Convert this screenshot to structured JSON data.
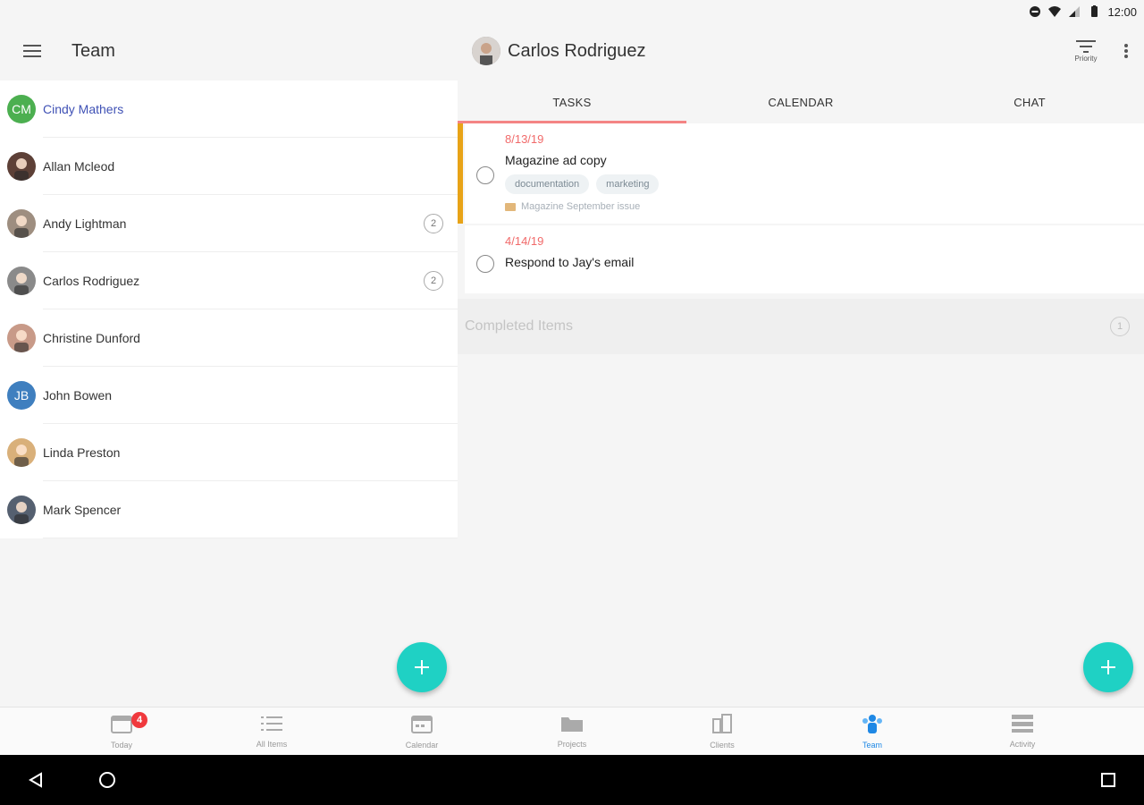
{
  "status_bar": {
    "time": "12:00"
  },
  "left": {
    "title": "Team",
    "members": [
      {
        "name": "Cindy Mathers",
        "initials": "CM",
        "avatar_color": "#4caf50",
        "selected": true,
        "count": ""
      },
      {
        "name": "Allan Mcleod",
        "initials": "",
        "avatar_color": "#5d4037",
        "selected": false,
        "count": ""
      },
      {
        "name": "Andy Lightman",
        "initials": "",
        "avatar_color": "#9e8e80",
        "selected": false,
        "count": "2"
      },
      {
        "name": "Carlos Rodriguez",
        "initials": "",
        "avatar_color": "#8a8a8a",
        "selected": false,
        "count": "2"
      },
      {
        "name": "Christine Dunford",
        "initials": "",
        "avatar_color": "#c89a88",
        "selected": false,
        "count": ""
      },
      {
        "name": "John Bowen",
        "initials": "JB",
        "avatar_color": "#3f7fbf",
        "selected": false,
        "count": ""
      },
      {
        "name": "Linda Preston",
        "initials": "",
        "avatar_color": "#d9b07a",
        "selected": false,
        "count": ""
      },
      {
        "name": "Mark Spencer",
        "initials": "",
        "avatar_color": "#556070",
        "selected": false,
        "count": ""
      }
    ]
  },
  "right": {
    "title": "Carlos Rodriguez",
    "filter_label": "Priority",
    "tabs": [
      {
        "label": "TASKS",
        "active": true
      },
      {
        "label": "CALENDAR",
        "active": false
      },
      {
        "label": "CHAT",
        "active": false
      }
    ],
    "tasks": [
      {
        "date": "8/13/19",
        "title": "Magazine ad copy",
        "tags": [
          "documentation",
          "marketing"
        ],
        "project": "Magazine September issue",
        "priority_color": "#e8a317"
      },
      {
        "date": "4/14/19",
        "title": "Respond to Jay's email",
        "tags": [],
        "project": "",
        "priority_color": ""
      }
    ],
    "completed_label": "Completed Items",
    "completed_count": "1"
  },
  "bottom_nav": [
    {
      "label": "Today",
      "icon": "calendar-today-icon",
      "badge": "4",
      "active": false
    },
    {
      "label": "All Items",
      "icon": "list-icon",
      "badge": "",
      "active": false
    },
    {
      "label": "Calendar",
      "icon": "calendar-icon",
      "badge": "",
      "active": false
    },
    {
      "label": "Projects",
      "icon": "folder-icon",
      "badge": "",
      "active": false
    },
    {
      "label": "Clients",
      "icon": "building-icon",
      "badge": "",
      "active": false
    },
    {
      "label": "Team",
      "icon": "team-icon",
      "badge": "",
      "active": true
    },
    {
      "label": "Activity",
      "icon": "activity-icon",
      "badge": "",
      "active": false
    }
  ],
  "colors": {
    "accent_fab": "#1fd1c4",
    "tab_indicator": "#f48484",
    "date_red": "#f16a6a",
    "active_nav": "#1e88e5"
  }
}
